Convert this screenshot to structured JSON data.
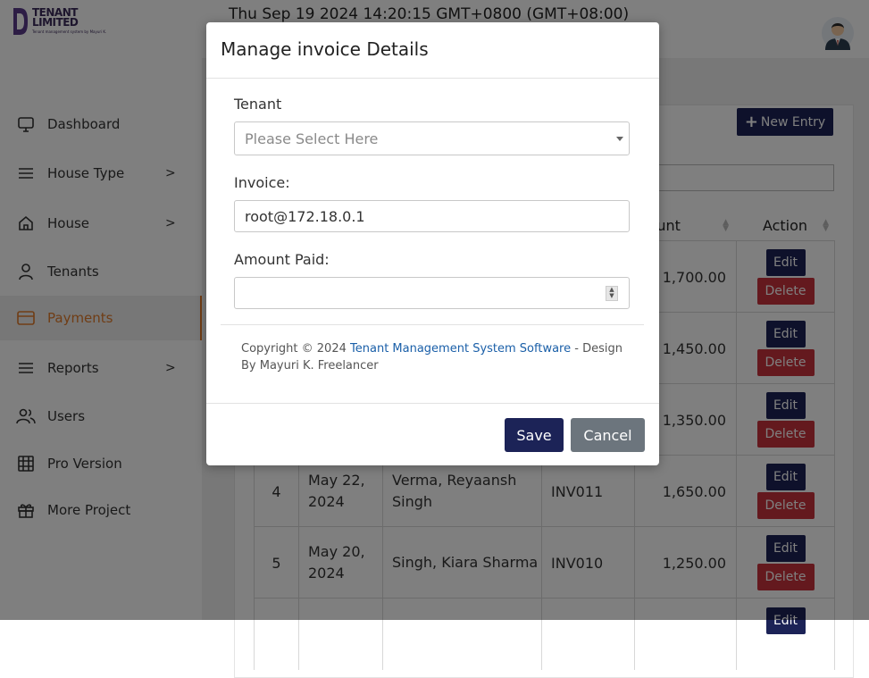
{
  "brand": {
    "title": "TENANT LIMITED",
    "tagline": "Tenant management system by Mayuri K."
  },
  "header": {
    "datetime": "Thu Sep 19 2024 14:20:15 GMT+0800 (GMT+08:00)"
  },
  "sidebar": {
    "items": [
      {
        "label": "Dashboard",
        "icon": "monitor-icon",
        "has_submenu": false,
        "active": false
      },
      {
        "label": "House Type",
        "icon": "list-icon",
        "has_submenu": true,
        "active": false
      },
      {
        "label": "House",
        "icon": "home-icon",
        "has_submenu": true,
        "active": false
      },
      {
        "label": "Tenants",
        "icon": "user-icon",
        "has_submenu": false,
        "active": false
      },
      {
        "label": "Payments",
        "icon": "credit-card-icon",
        "has_submenu": false,
        "active": true
      },
      {
        "label": "Reports",
        "icon": "list-icon",
        "has_submenu": true,
        "active": false
      },
      {
        "label": "Users",
        "icon": "users-icon",
        "has_submenu": false,
        "active": false
      },
      {
        "label": "Pro Version",
        "icon": "table-icon",
        "has_submenu": false,
        "active": false
      },
      {
        "label": "More Project",
        "icon": "gift-icon",
        "has_submenu": false,
        "active": false
      }
    ],
    "chevron": ">"
  },
  "content": {
    "new_entry_label": "New Entry",
    "table_headers": {
      "amount": "mount",
      "action": "Action"
    },
    "rows": [
      {
        "no": "",
        "date": "",
        "tenant": "",
        "invoice": "",
        "amount": "1,700.00"
      },
      {
        "no": "",
        "date": "",
        "tenant": "",
        "invoice": "",
        "amount": "1,450.00"
      },
      {
        "no": "",
        "date": "",
        "tenant": "",
        "invoice": "",
        "amount": "1,350.00"
      },
      {
        "no": "4",
        "date": "May 22, 2024",
        "tenant": "Verma, Reyaansh Singh",
        "invoice": "INV011",
        "amount": "1,650.00"
      },
      {
        "no": "5",
        "date": "May 20, 2024",
        "tenant": "Singh, Kiara Sharma",
        "invoice": "INV010",
        "amount": "1,250.00"
      },
      {
        "no": "",
        "date": "",
        "tenant": "",
        "invoice": "",
        "amount": ""
      }
    ],
    "edit_label": "Edit",
    "delete_label": "Delete"
  },
  "modal": {
    "title": "Manage invoice Details",
    "tenant_label": "Tenant",
    "tenant_placeholder": "Please Select Here",
    "invoice_label": "Invoice:",
    "invoice_value": "root@172.18.0.1",
    "amount_label": "Amount Paid:",
    "amount_value": "",
    "copyright_prefix": "Copyright © 2024",
    "copyright_link": "Tenant Management System Software",
    "copyright_suffix": "- Design By Mayuri K. Freelancer",
    "save_label": "Save",
    "cancel_label": "Cancel"
  },
  "colors": {
    "accent": "#e07b2a",
    "primary": "#1c2357",
    "danger": "#c8323c",
    "secondary": "#6c757d",
    "link": "#1a5fa8"
  }
}
